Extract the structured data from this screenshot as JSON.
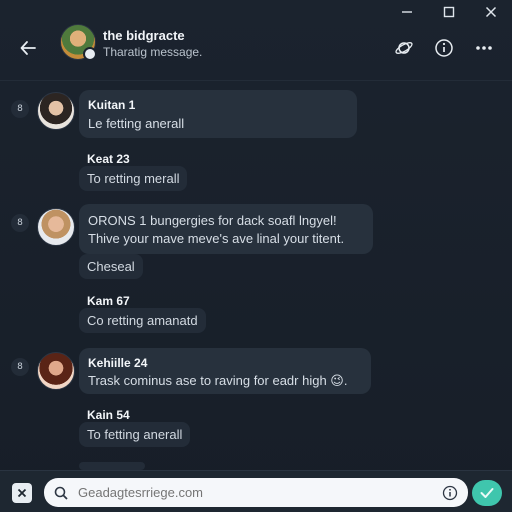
{
  "window": {
    "controls": [
      "minimize",
      "maximize",
      "close"
    ]
  },
  "header": {
    "title": "the bidgracte",
    "subtitle": "Tharatig message."
  },
  "messages": [
    {
      "marker": "8",
      "sender": "Kuitan 1",
      "text": "Le fetting anerall",
      "avatar": "avatar-a"
    },
    {
      "sender": "Keat 23",
      "text": "To retting merall"
    },
    {
      "marker": "8",
      "text_line1": "ORONS 1 bungergies for dack soafl lngyel!",
      "text_line2": "Thive your mave meve's ave linal your titent.",
      "avatar": "avatar-b"
    },
    {
      "text": "Cheseal"
    },
    {
      "sender": "Kam 67",
      "text": "Co retting amanatd"
    },
    {
      "marker": "8",
      "sender": "Kehiille 24",
      "text": "Trask cominus ase to raving for eadr high 😉.",
      "avatar": "avatar-c"
    },
    {
      "sender": "Kain 54",
      "text": "To fetting anerall"
    }
  ],
  "composer": {
    "placeholder": "Geadagtesrriege.com",
    "value": ""
  },
  "colors": {
    "background": "#161d27",
    "bubble": "#27313d",
    "accent": "#3fc6ad"
  },
  "icons": [
    "back-arrow-icon",
    "planet-icon",
    "info-icon",
    "more-icon",
    "search-icon",
    "close-icon",
    "send-icon"
  ]
}
